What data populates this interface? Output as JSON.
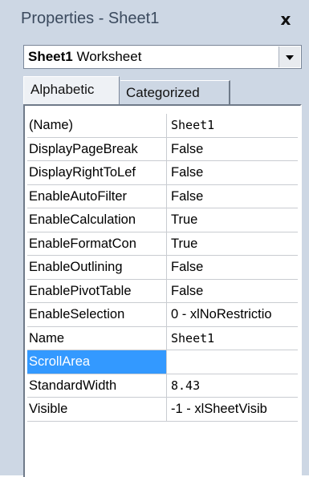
{
  "window": {
    "title": "Properties - Sheet1",
    "close_glyph": "x"
  },
  "object_selector": {
    "name": "Sheet1",
    "type": "Worksheet"
  },
  "tabs": [
    {
      "label": "Alphabetic",
      "active": true
    },
    {
      "label": "Categorized",
      "active": false
    }
  ],
  "properties": [
    {
      "name": "(Name)",
      "value": "Sheet1",
      "mono": true
    },
    {
      "name": "DisplayPageBreak",
      "value": "False"
    },
    {
      "name": "DisplayRightToLef",
      "value": "False"
    },
    {
      "name": "EnableAutoFilter",
      "value": "False"
    },
    {
      "name": "EnableCalculation",
      "value": "True"
    },
    {
      "name": "EnableFormatCon",
      "value": "True"
    },
    {
      "name": "EnableOutlining",
      "value": "False"
    },
    {
      "name": "EnablePivotTable",
      "value": "False"
    },
    {
      "name": "EnableSelection",
      "value": "0 - xlNoRestrictio"
    },
    {
      "name": "Name",
      "value": "Sheet1",
      "mono": true
    },
    {
      "name": "ScrollArea",
      "value": "",
      "selected": true
    },
    {
      "name": "StandardWidth",
      "value": "8.43",
      "mono": true
    },
    {
      "name": "Visible",
      "value": "-1 - xlSheetVisib"
    }
  ],
  "colors": {
    "panel_bg": "#cdd7e4",
    "selection": "#3399ff"
  }
}
